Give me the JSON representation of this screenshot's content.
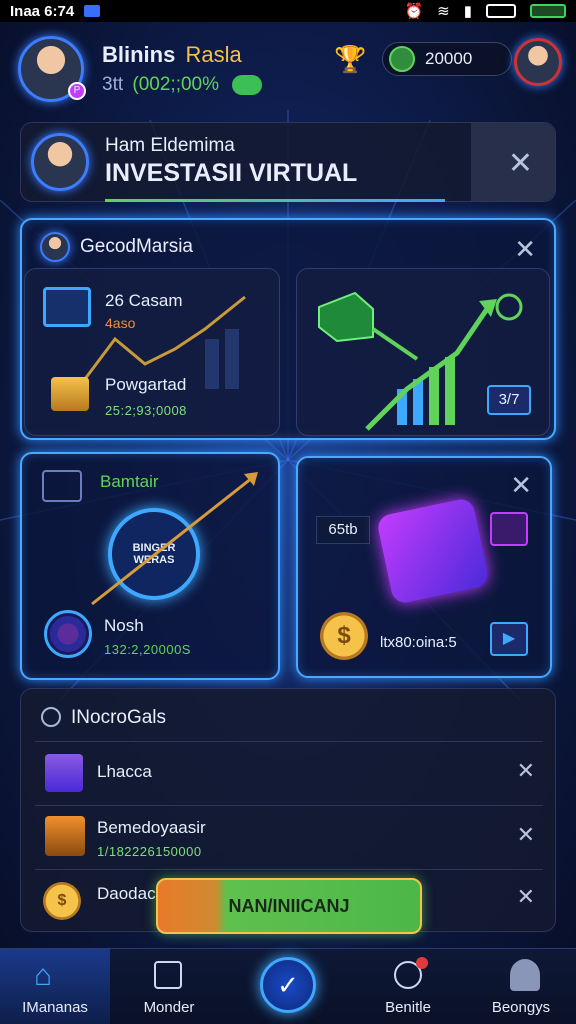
{
  "status": {
    "time": "Inaa 6:74"
  },
  "header": {
    "user_name": "Blinins",
    "user_tag": "Rasla",
    "stat": "3tt",
    "balance_text": "(002;;00%",
    "coins": "20000"
  },
  "banner": {
    "subtitle": "Ham Eldemima",
    "title": "INVESTASII VIRTUAL"
  },
  "panel": {
    "title": "GecodMarsia"
  },
  "tile1": {
    "label": "26 Casam",
    "sub": "4aso",
    "item_label": "Powgartad",
    "item_value": "25:2;93;0008"
  },
  "tile2": {
    "badge": "3/7"
  },
  "tile3": {
    "label": "Bamtair",
    "shield_line1": "BINGER",
    "shield_line2": "WERAS",
    "item_label": "Nosh",
    "item_value": "132:2,20000S"
  },
  "tile4": {
    "chip": "65tb",
    "value": "ltx80:oina:5"
  },
  "list": {
    "title": "INocroGals",
    "items": [
      {
        "label": "Lhacca"
      },
      {
        "label": "Bemedoyaasir",
        "value": "1/182226150000"
      },
      {
        "label": "Daodac"
      }
    ]
  },
  "cta": {
    "label": "NAN/INIICANJ"
  },
  "nav": [
    {
      "label": "IMananas"
    },
    {
      "label": "Monder"
    },
    {
      "label": ""
    },
    {
      "label": "Benitle"
    },
    {
      "label": "Beongys"
    }
  ],
  "colors": {
    "accent": "#4aa8ff",
    "green": "#5fd35a",
    "orange": "#f0902e",
    "gold": "#f5c24a"
  }
}
